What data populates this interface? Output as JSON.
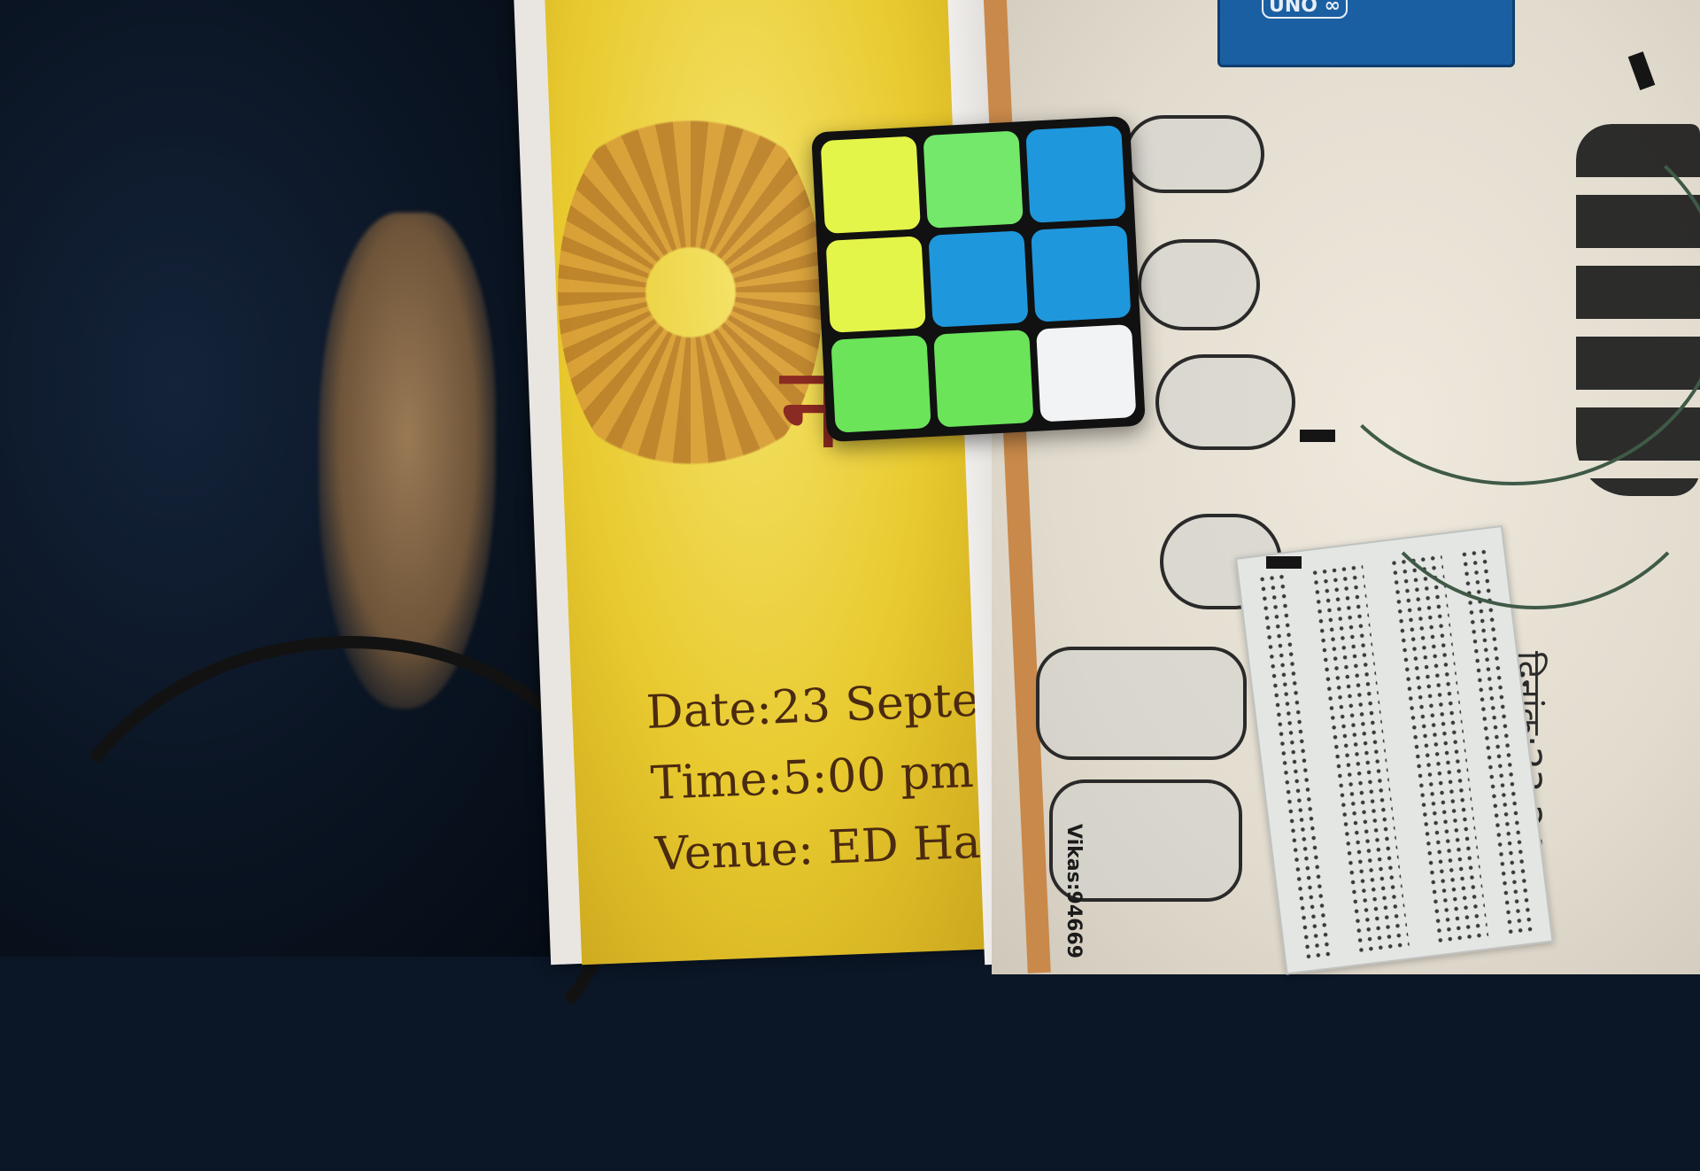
{
  "poster": {
    "glyph": "न",
    "date_line": "Date:23 Septe",
    "time_line": "Time:5:00 pm",
    "venue_line": "Venue: ED Ha"
  },
  "sheet": {
    "phone_label": "Vikas:94669",
    "hindi_date": "दिनांक:23-24 Sep",
    "arduino_label": "UNO ∞"
  },
  "cube": {
    "stickers": [
      "#e4f54a",
      "#74e86a",
      "#1f97dc",
      "#e4f54a",
      "#1f97dc",
      "#1f97dc",
      "#6be45a",
      "#6be45a",
      "#f2f3f5"
    ]
  },
  "colors": {
    "poster_yellow": "#e8c92e",
    "breadboard": "#e4e6e4",
    "arduino_blue": "#1b5fa3",
    "wire_green": "#3f5a47"
  }
}
